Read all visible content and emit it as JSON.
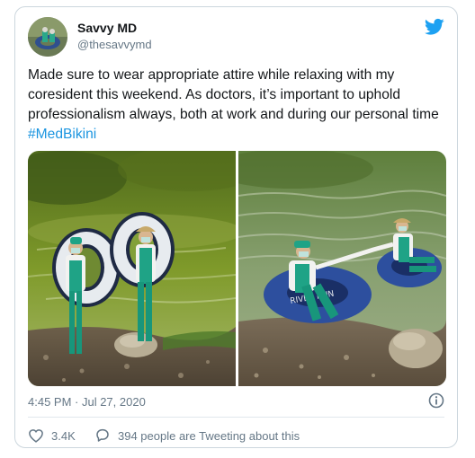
{
  "author": {
    "display_name": "Savvy MD",
    "handle": "@thesavvymd",
    "avatar_icon": "avatar-photo"
  },
  "brand": {
    "icon": "twitter-bird-icon",
    "color": "#1da1f2"
  },
  "tweet": {
    "text": "Made sure to wear appropriate attire while relaxing with my coresident this weekend. As doctors, it’s important to  uphold professionalism always, both at work and during our personal time ",
    "hashtag": "#MedBikini",
    "hashtag_color": "#1b95e0",
    "media": [
      {
        "kind": "photo",
        "content": "two people in teal scrubs and face masks holding inner tubes at a riverbank"
      },
      {
        "kind": "photo",
        "content": "two people in teal scrubs floating on inner tubes in a river"
      }
    ]
  },
  "meta": {
    "timestamp": "4:45 PM · Jul 27, 2020",
    "info_icon": "info-icon"
  },
  "actions": {
    "likes_count": "3.4K",
    "like_icon": "heart-icon",
    "conversation_text": "394 people are Tweeting about this",
    "conversation_icon": "speech-bubble-icon"
  }
}
